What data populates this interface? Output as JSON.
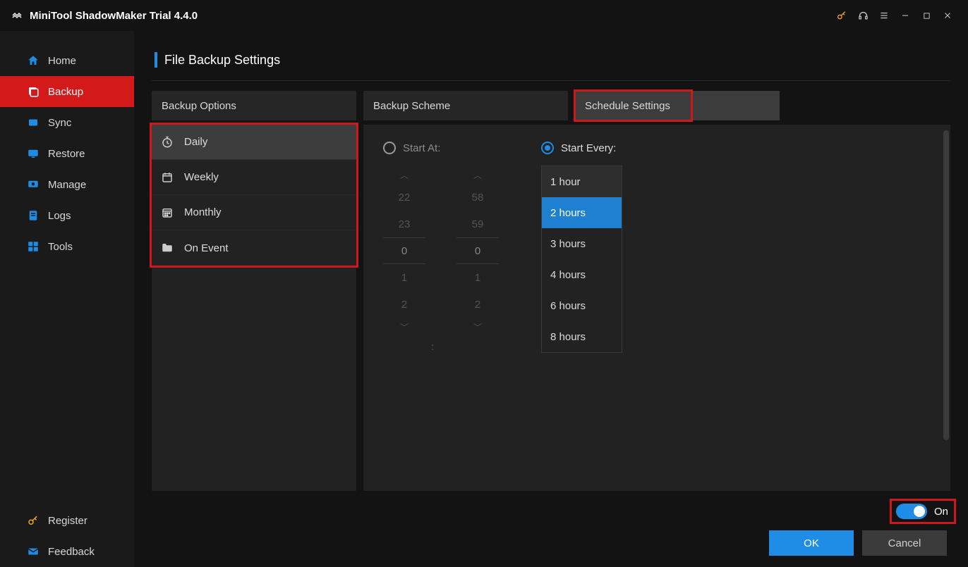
{
  "app": {
    "title": "MiniTool ShadowMaker Trial 4.4.0"
  },
  "sidebar": {
    "items": [
      {
        "label": "Home",
        "icon": "home-icon"
      },
      {
        "label": "Backup",
        "icon": "backup-icon",
        "active": true
      },
      {
        "label": "Sync",
        "icon": "sync-icon"
      },
      {
        "label": "Restore",
        "icon": "restore-icon"
      },
      {
        "label": "Manage",
        "icon": "manage-icon"
      },
      {
        "label": "Logs",
        "icon": "logs-icon"
      },
      {
        "label": "Tools",
        "icon": "tools-icon"
      }
    ],
    "footer": [
      {
        "label": "Register",
        "icon": "key-icon"
      },
      {
        "label": "Feedback",
        "icon": "mail-icon"
      }
    ]
  },
  "page": {
    "title": "File Backup Settings"
  },
  "tabs": {
    "options": "Backup Options",
    "scheme": "Backup Scheme",
    "schedule": "Schedule Settings",
    "active": "schedule"
  },
  "frequency": {
    "items": [
      "Daily",
      "Weekly",
      "Monthly",
      "On Event"
    ],
    "active": "Daily"
  },
  "schedule": {
    "startAt": {
      "label": "Start At:",
      "selected": false
    },
    "startEvery": {
      "label": "Start Every:",
      "selected": true
    },
    "time_hours_visible": [
      "22",
      "23",
      "0",
      "1",
      "2"
    ],
    "time_minutes_visible": [
      "58",
      "59",
      "0",
      "1",
      "2"
    ],
    "time_separator": ":",
    "intervals": [
      "1 hour",
      "2 hours",
      "3 hours",
      "4 hours",
      "6 hours",
      "8 hours"
    ],
    "interval_selected": "2 hours"
  },
  "toggle": {
    "label": "On",
    "state": true
  },
  "buttons": {
    "ok": "OK",
    "cancel": "Cancel"
  }
}
